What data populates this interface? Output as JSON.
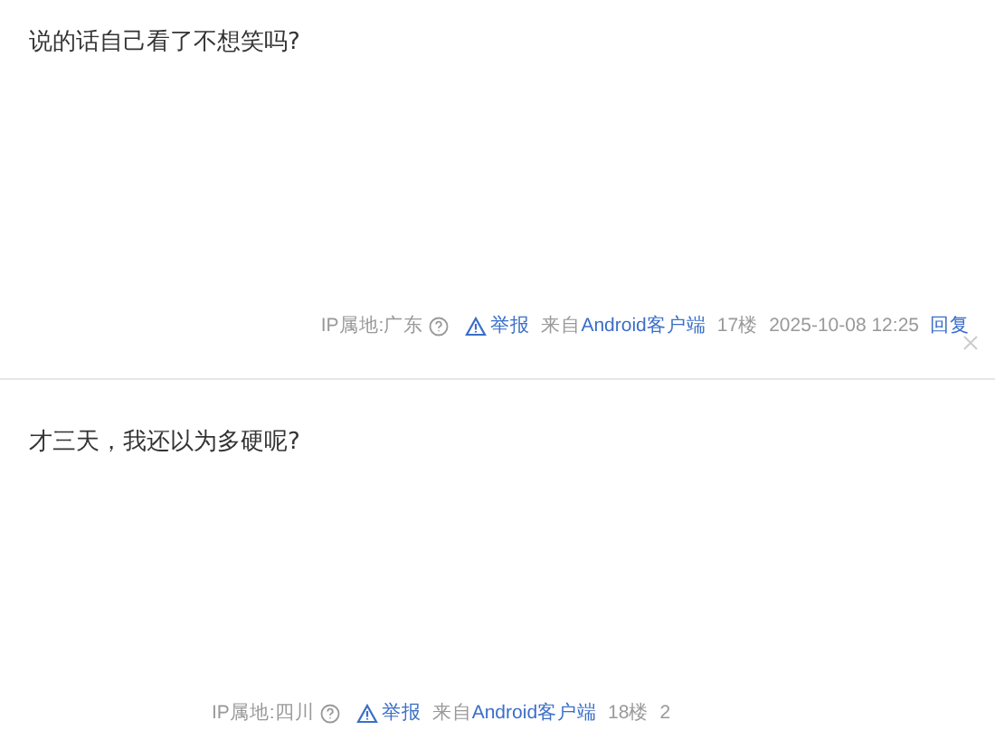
{
  "posts": [
    {
      "content": "说的话自己看了不想笑吗?",
      "ip": "IP属地:广东",
      "report": "举报",
      "source_prefix": "来自",
      "source": "Android客户端",
      "floor": "17楼",
      "time": "2025-10-08 12:25",
      "reply": "回复",
      "closable": true
    },
    {
      "content": "才三天，我还以为多硬呢?",
      "ip": "IP属地:四川",
      "report": "举报",
      "source_prefix": "来自",
      "source": "Android客户端",
      "floor": "18楼",
      "time": "2",
      "closable": false
    }
  ]
}
